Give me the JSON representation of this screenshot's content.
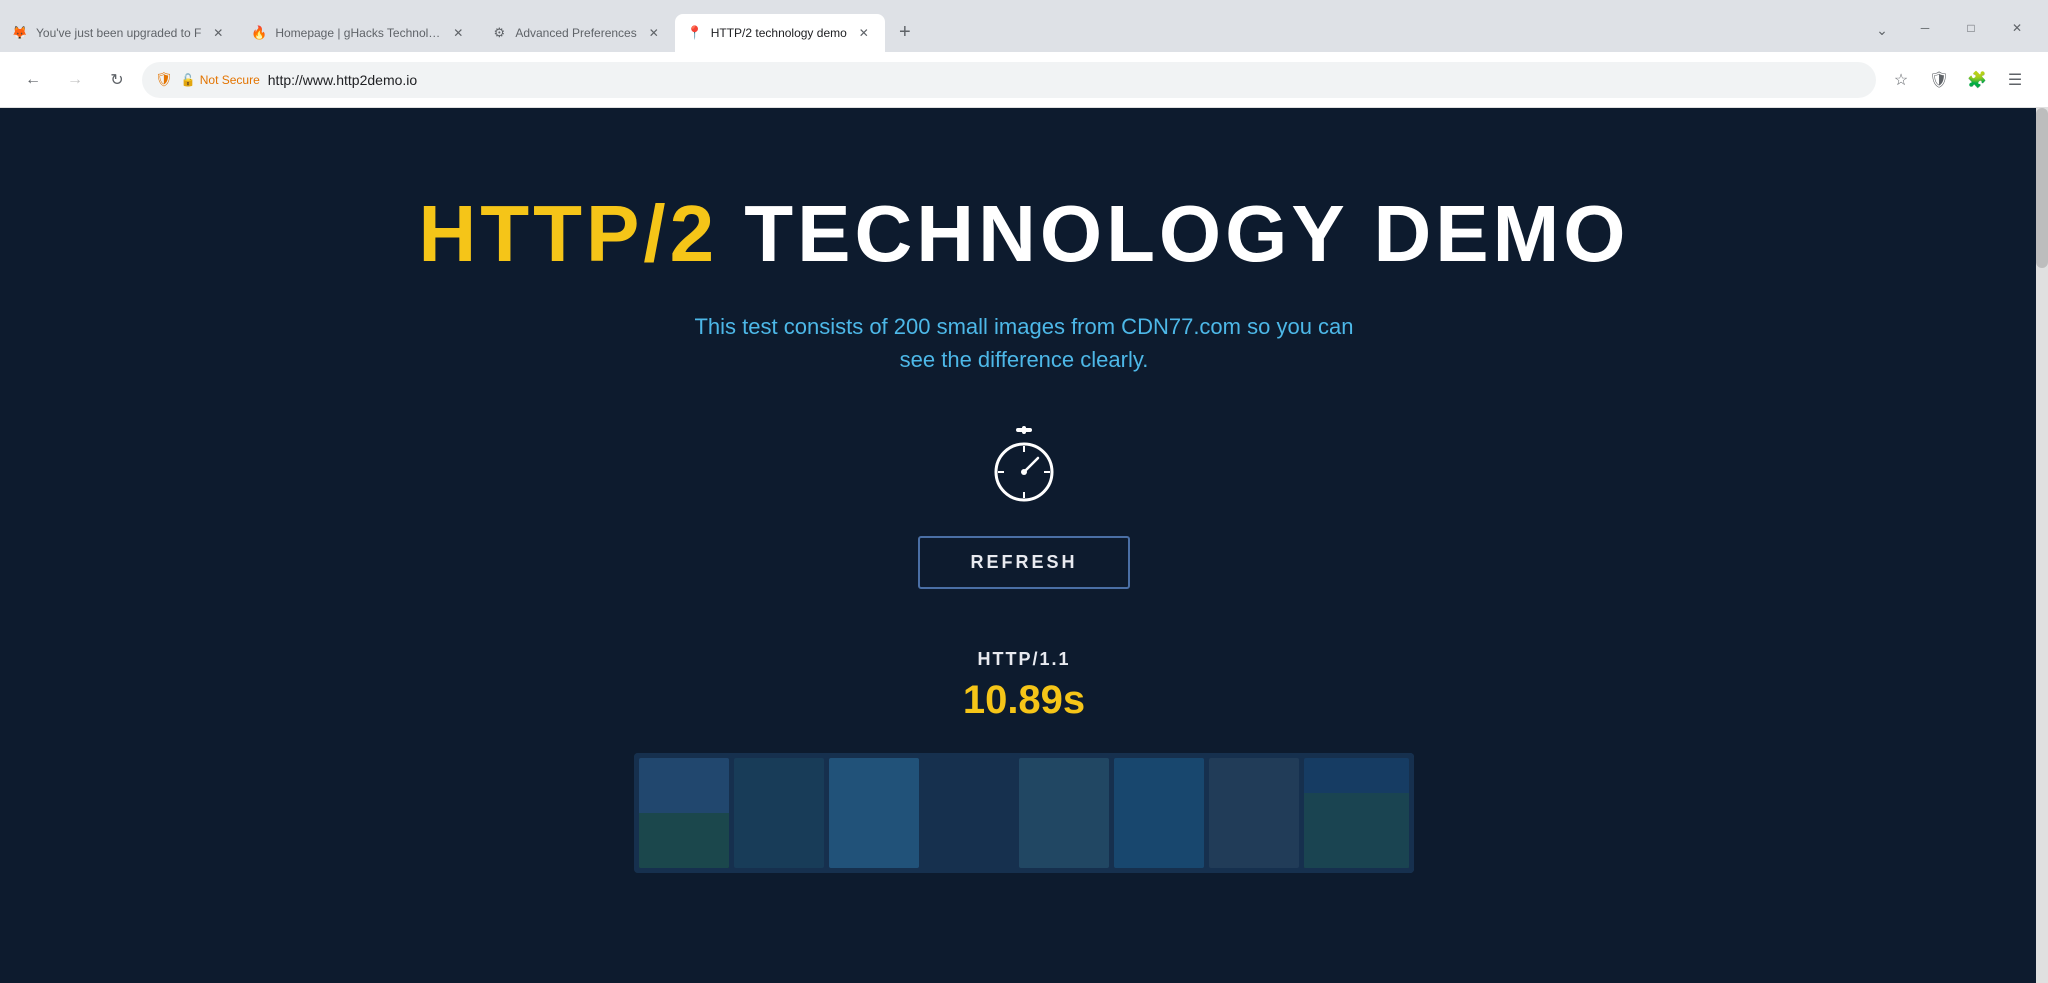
{
  "tabs": [
    {
      "id": "tab1",
      "title": "You've just been upgraded to F",
      "favicon": "📄",
      "active": false,
      "closeable": true,
      "favicon_type": "firefox"
    },
    {
      "id": "tab2",
      "title": "Homepage | gHacks Technolog",
      "favicon": "🔥",
      "active": false,
      "closeable": true,
      "favicon_type": "ghacks"
    },
    {
      "id": "tab3",
      "title": "Advanced Preferences",
      "favicon": "⚙",
      "active": false,
      "closeable": true,
      "favicon_type": "gear"
    },
    {
      "id": "tab4",
      "title": "HTTP/2 technology demo",
      "favicon": "📍",
      "active": true,
      "closeable": true,
      "favicon_type": "active"
    }
  ],
  "toolbar": {
    "back_disabled": false,
    "forward_disabled": true,
    "url": "http://www.http2demo.io",
    "security_label": "Not Secure",
    "bookmark_label": "Bookmark",
    "shield_label": "Shield",
    "extensions_label": "Extensions",
    "menu_label": "Menu"
  },
  "page": {
    "heading_colored": "HTTP/2",
    "heading_rest": " TECHNOLOGY DEMO",
    "subtitle": "This test consists of 200 small images from CDN77.com so you can see the difference clearly.",
    "refresh_button": "REFRESH",
    "http_version_label": "HTTP/1.1",
    "http_time": "10.89s",
    "background_color": "#0d1b2e",
    "heading_color": "#f5c518",
    "subtitle_color": "#4db8e8",
    "time_color": "#f5c518"
  },
  "window_controls": {
    "minimize": "─",
    "maximize": "□",
    "close": "✕"
  }
}
